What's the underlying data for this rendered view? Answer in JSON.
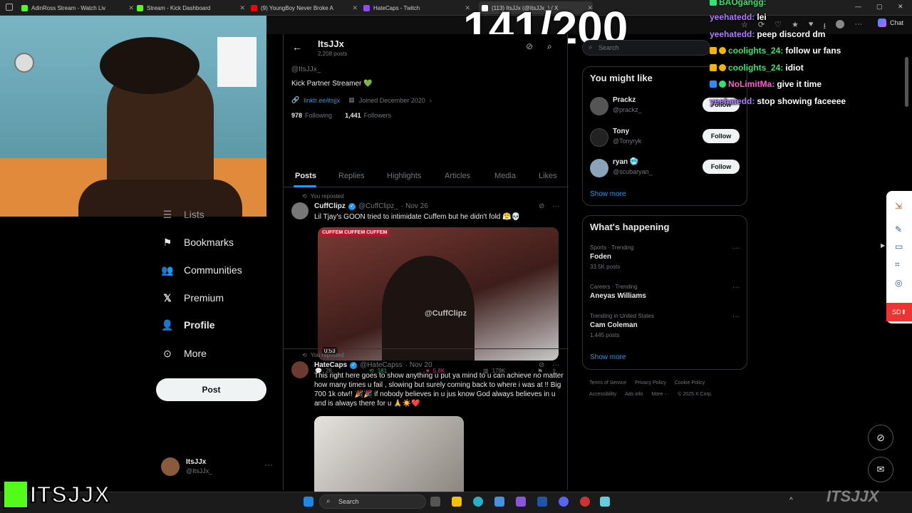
{
  "browser": {
    "tabs": [
      {
        "title": "AdinRoss Stream - Watch Liv",
        "color": "#53fc18"
      },
      {
        "title": "Stream - Kick Dashboard",
        "color": "#53fc18"
      },
      {
        "title": "(9) YoungBoy Never Broke A",
        "color": "#ff0000"
      },
      {
        "title": "HateCaps - Twitch",
        "color": "#9146ff"
      },
      {
        "title": "(113) ItsJJx (@ItsJJx_) / X",
        "color": "#ffffff"
      }
    ],
    "chat_button": "Chat"
  },
  "overlay": {
    "counter": "141/200",
    "brand": "ITSJJX"
  },
  "sidebar": {
    "items": [
      {
        "label": "Lists",
        "icon": "list-icon"
      },
      {
        "label": "Bookmarks",
        "icon": "bookmark-icon"
      },
      {
        "label": "Communities",
        "icon": "communities-icon"
      },
      {
        "label": "Premium",
        "icon": "x-logo-icon"
      },
      {
        "label": "Profile",
        "icon": "profile-icon"
      },
      {
        "label": "More",
        "icon": "more-icon"
      }
    ],
    "post_button": "Post",
    "account": {
      "name": "ItsJJx",
      "handle": "@ItsJJx_"
    }
  },
  "profile": {
    "header_name": "ItsJJx",
    "header_posts": "2,208 posts",
    "handle": "@ItsJJx_",
    "bio": "Kick Partner Streamer 💚",
    "link": "linktr.ee/itsjjx",
    "joined": "Joined December 2020",
    "following_count": "978",
    "following_label": "Following",
    "followers_count": "1,441",
    "followers_label": "Followers",
    "tabs": [
      "Posts",
      "Replies",
      "Highlights",
      "Articles",
      "Media",
      "Likes"
    ]
  },
  "posts": [
    {
      "repost_label": "You reposted",
      "author": "CuffClipz",
      "handle": "@CuffClipz_",
      "date": "· Nov 26",
      "text": "Lil Tjay's GOON tried to intimidate Cuffem but he didn't fold 😤💀",
      "video_duration": "0:53",
      "video_watermark": "@CuffClipz",
      "video_banner": "CUFFEM CUFFEM CUFFEM",
      "replies": "28",
      "reposts": "181",
      "likes": "5.8K",
      "views": "179K"
    },
    {
      "repost_label": "You reposted",
      "author": "HateCaps",
      "handle": "@HateCapss",
      "date": "· Nov 20",
      "text": "This right here goes to show anything u put ya mind to u can achieve no matter how many times u fail , slowing but surely coming back to where i was at !! Big 700 1k otw!! 🎉🎉 if nobody believes in u jus know God always believes in u and is always there for u 🙏☀️❤️"
    }
  ],
  "right": {
    "search_placeholder": "Search",
    "might_like_title": "You might like",
    "suggestions": [
      {
        "name": "Prackz",
        "handle": "@prackz_",
        "button": "Follow"
      },
      {
        "name": "Tony",
        "handle": "@Tonyryk",
        "button": "Follow"
      },
      {
        "name": "ryan 🥶",
        "handle": "@scubaryan_",
        "button": "Follow"
      }
    ],
    "show_more": "Show more",
    "happening_title": "What's happening",
    "trends": [
      {
        "category": "Sports · Trending",
        "name": "Foden",
        "count": "33.5K posts"
      },
      {
        "category": "Careers · Trending",
        "name": "Aneyas Williams",
        "count": ""
      },
      {
        "category": "Trending in United States",
        "name": "Cam Coleman",
        "count": "1,445 posts"
      }
    ],
    "footer": [
      "Terms of Service",
      "Privacy Policy",
      "Cookie Policy",
      "Accessibility",
      "Ads info",
      "More ···",
      "© 2025 X Corp."
    ]
  },
  "chat": [
    {
      "user": "BAOgangg:",
      "msg": ""
    },
    {
      "user": "yeehatedd:",
      "msg": "lei"
    },
    {
      "user": "yeehatedd:",
      "msg": "peep discord dm"
    },
    {
      "user": "coolights_24:",
      "msg": "follow ur fans"
    },
    {
      "user": "coolights_24:",
      "msg": "idiot"
    },
    {
      "user": "NoLimitMa:",
      "msg": "give it time"
    },
    {
      "user": "yeehatedd:",
      "msg": "stop showing faceeee"
    }
  ],
  "taskbar": {
    "search": "Search"
  }
}
